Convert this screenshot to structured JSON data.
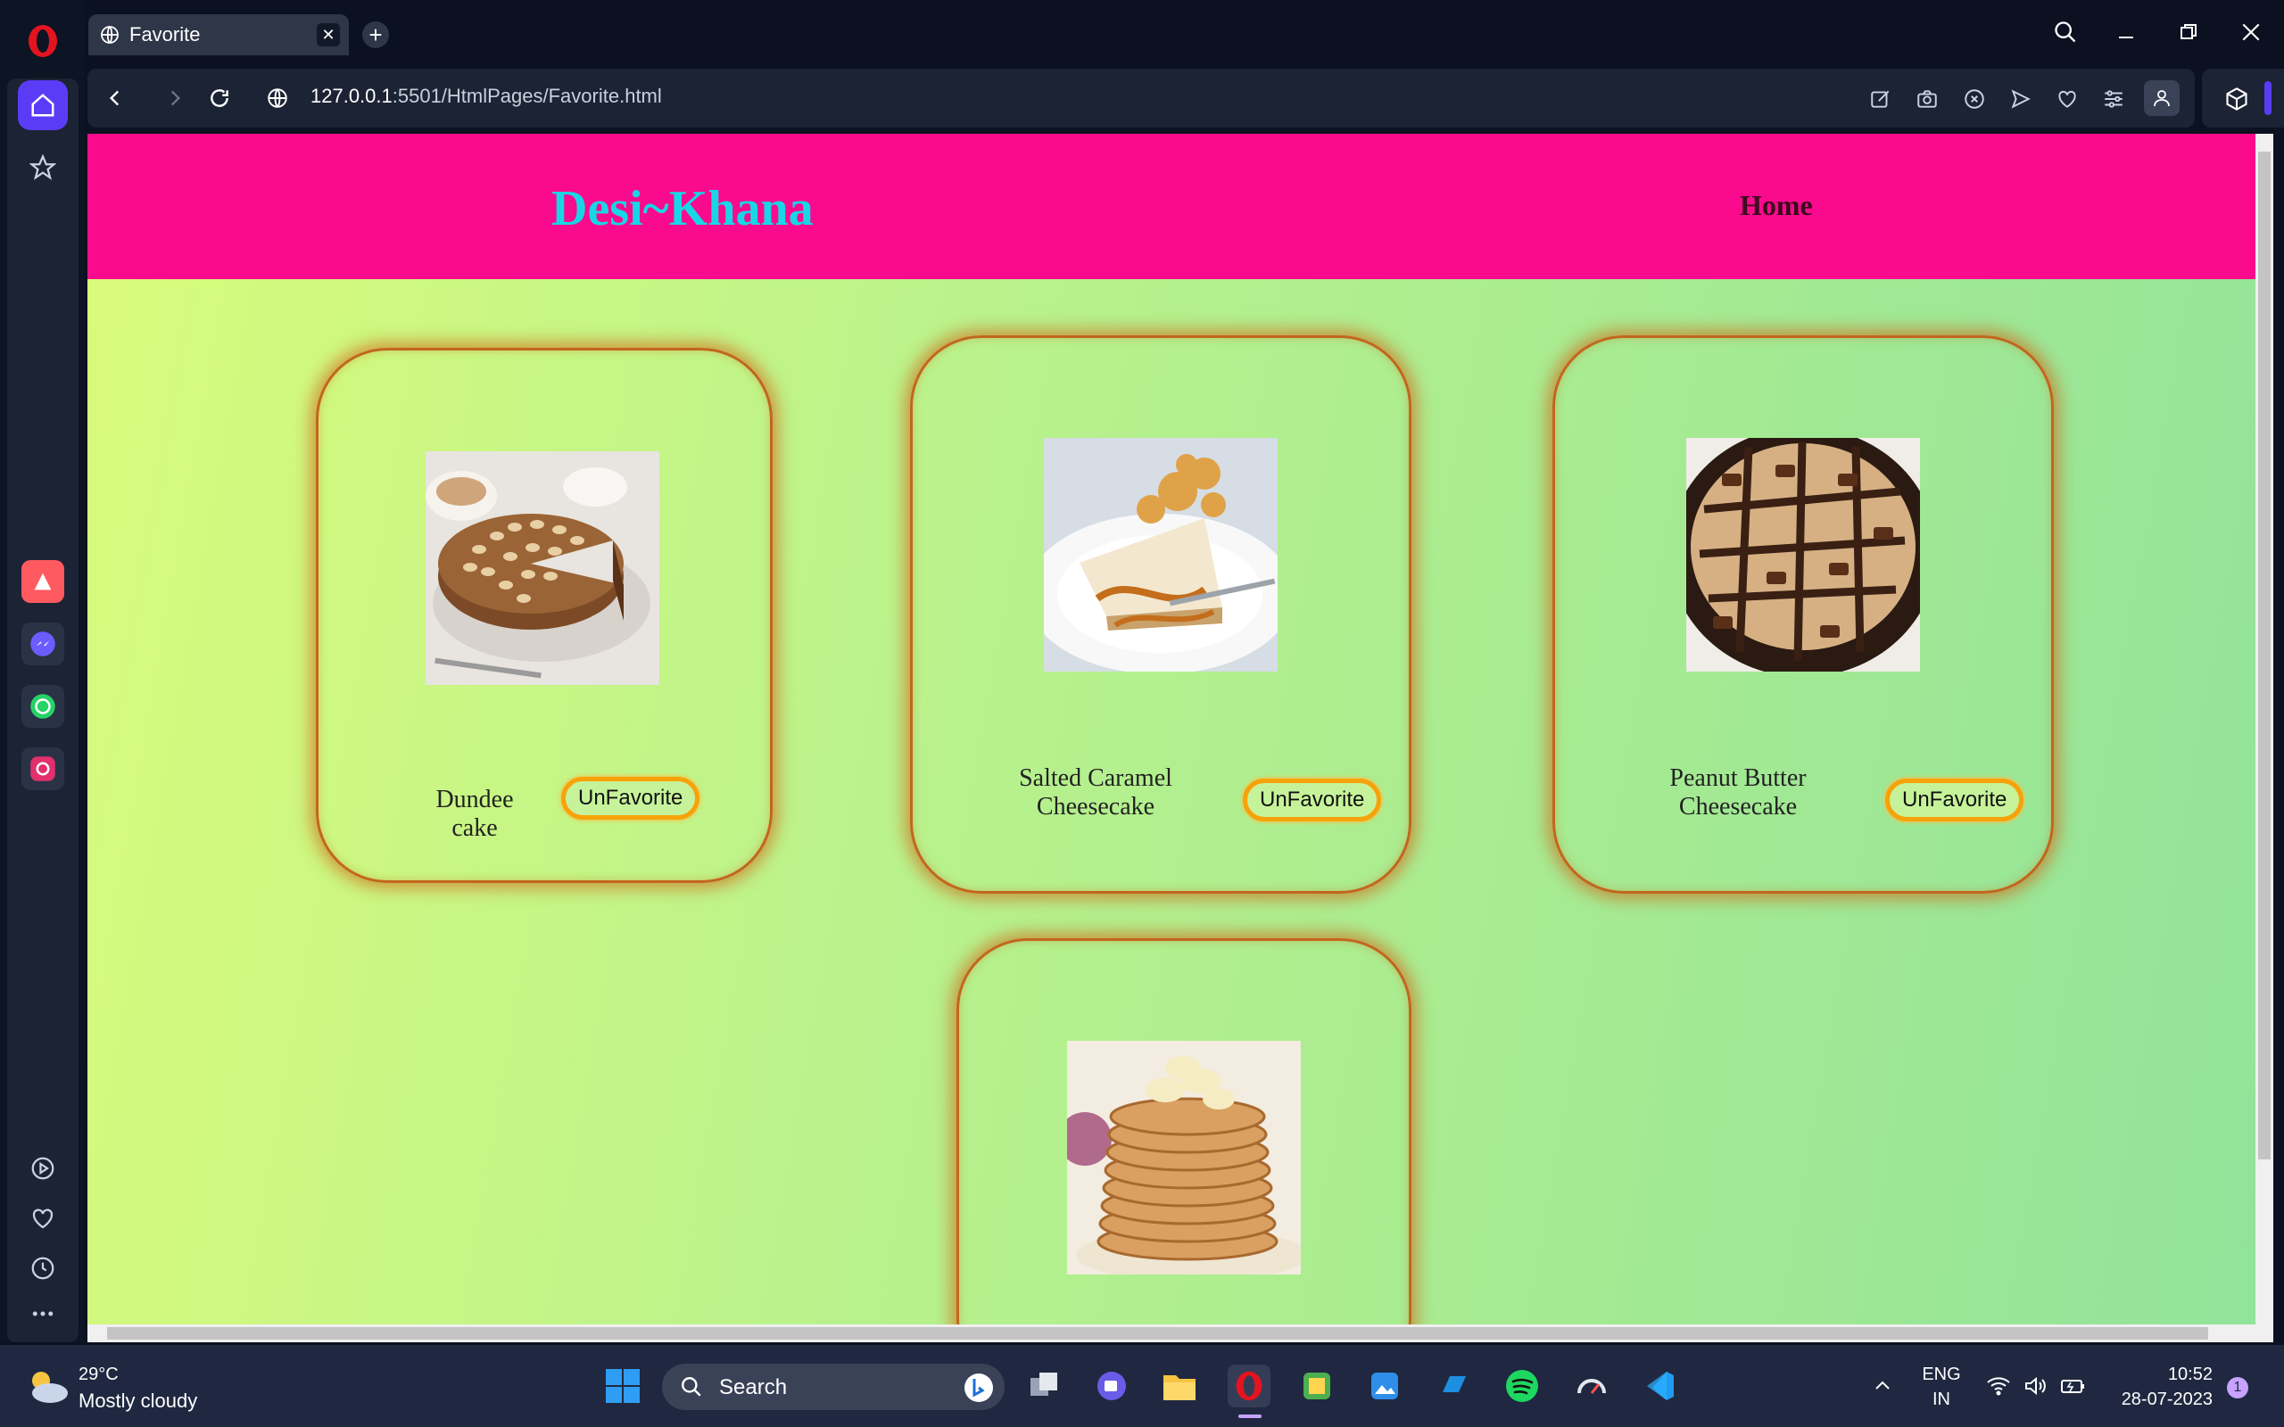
{
  "browser": {
    "tab": {
      "title": "Favorite"
    },
    "url": {
      "host": "127.0.0.1",
      "path": ":5501/HtmlPages/Favorite.html"
    }
  },
  "page": {
    "brand": "Desi~Khana",
    "nav": {
      "home": "Home"
    },
    "favorites": [
      {
        "name": "Dundee cake",
        "button": "UnFavorite"
      },
      {
        "name": "Salted Caramel Cheesecake",
        "button": "UnFavorite"
      },
      {
        "name": "Peanut Butter Cheesecake",
        "button": "UnFavorite"
      },
      {
        "name": "",
        "button": ""
      }
    ]
  },
  "taskbar": {
    "weather": {
      "temp": "29°C",
      "desc": "Mostly cloudy"
    },
    "search_label": "Search",
    "lang": {
      "line1": "ENG",
      "line2": "IN"
    },
    "clock": {
      "time": "10:52",
      "date": "28-07-2023"
    },
    "notification_count": "1"
  },
  "colors": {
    "header_bg": "#fa0a8c",
    "brand": "#18d6e6",
    "button_border": "#f8a20a",
    "card_border": "#c2661e"
  }
}
